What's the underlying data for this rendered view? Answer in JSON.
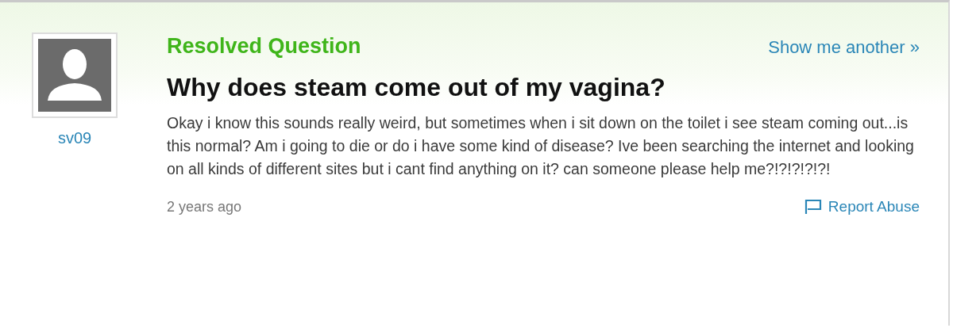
{
  "user": {
    "name": "sv09"
  },
  "header": {
    "status": "Resolved Question",
    "link": "Show me another »"
  },
  "question": {
    "title": "Why does steam come out of my vagina?",
    "body": "Okay i know this sounds really weird, but sometimes when i sit down on the toilet i see steam coming out...is this normal? Am i going to die or do i have some kind of disease? Ive been searching the internet and looking on all kinds of different sites but i cant find anything on it? can someone please help me?!?!?!?!?!",
    "time": "2 years ago"
  },
  "actions": {
    "report": "Report Abuse"
  }
}
